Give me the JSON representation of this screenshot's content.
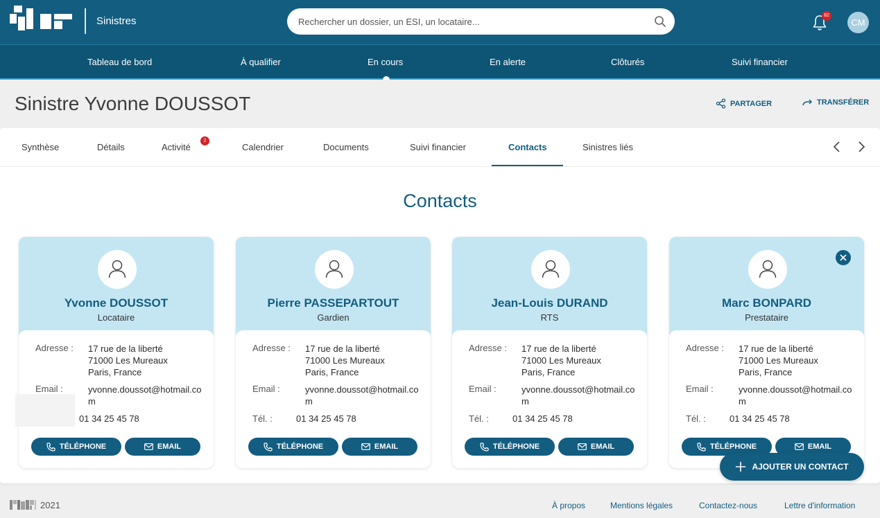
{
  "header": {
    "app_name": "Sinistres",
    "search_placeholder": "Rechercher un dossier, un ESI, un locataire...",
    "notification_count": "82",
    "user_initials": "CM"
  },
  "nav": {
    "items": [
      "Tableau de bord",
      "À qualifier",
      "En cours",
      "En alerte",
      "Clôturés",
      "Suivi financier"
    ],
    "active": "En cours"
  },
  "page": {
    "title": "Sinistre Yvonne DOUSSOT",
    "share_label": "PARTAGER",
    "transfer_label": "TRANSFÉRER"
  },
  "tabs": {
    "items": [
      "Synthèse",
      "Détails",
      "Activité",
      "Calendrier",
      "Documents",
      "Suivi financier",
      "Contacts",
      "Sinistres liés"
    ],
    "active": "Contacts",
    "activity_badge": "2"
  },
  "section_title": "Contacts",
  "labels": {
    "address": "Adresse :",
    "email": "Email :",
    "tel": "Tél. :",
    "phone_button": "TÉLÉPHONE",
    "email_button": "EMAIL"
  },
  "contacts": [
    {
      "name": "Yvonne DOUSSOT",
      "role": "Locataire",
      "address_line1": "17 rue de la liberté",
      "address_line2": "71000 Les Mureaux",
      "address_line3": "Paris, France",
      "email": "yvonne.doussot@hotmail.com",
      "tel": "01 34 25 45 78"
    },
    {
      "name": "Pierre PASSEPARTOUT",
      "role": "Gardien",
      "address_line1": "17 rue de la liberté",
      "address_line2": "71000 Les Mureaux",
      "address_line3": "Paris, France",
      "email": "yvonne.doussot@hotmail.com",
      "tel": "01 34 25 45 78"
    },
    {
      "name": "Jean-Louis DURAND",
      "role": "RTS",
      "address_line1": "17 rue de la liberté",
      "address_line2": "71000 Les Mureaux",
      "address_line3": "Paris, France",
      "email": "yvonne.doussot@hotmail.com",
      "tel": "01 34 25 45 78"
    },
    {
      "name": "Marc BONPARD",
      "role": "Prestataire",
      "address_line1": "17 rue de la liberté",
      "address_line2": "71000 Les Mureaux",
      "address_line3": "Paris, France",
      "email": "yvonne.doussot@hotmail.com",
      "tel": "01 34 25 45 78"
    }
  ],
  "add_contact_label": "AJOUTER UN CONTACT",
  "footer": {
    "year": "2021",
    "links": [
      "À propos",
      "Mentions légales",
      "Contactez-nous",
      "Lettre d'information"
    ]
  },
  "colors": {
    "primary": "#125d80",
    "card_header": "#c4e6f3",
    "badge": "#d4232b"
  }
}
